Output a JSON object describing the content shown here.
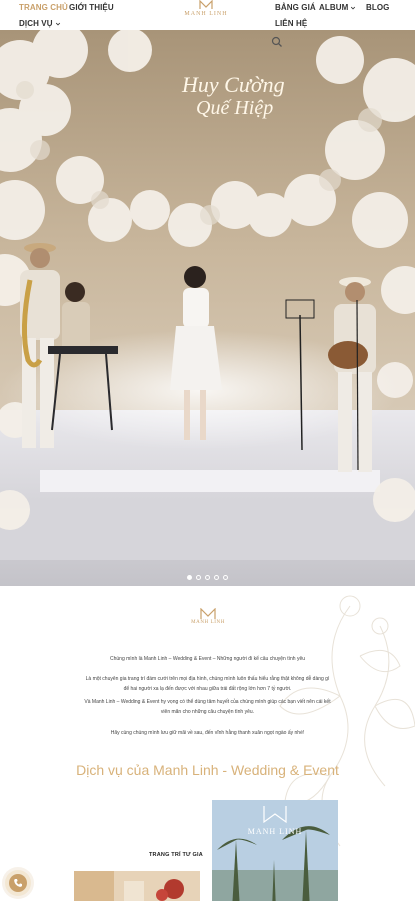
{
  "nav": {
    "home": "TRANG CHỦ",
    "about": "GIỚI THIỆU",
    "services": "DỊCH VỤ",
    "pricing": "BẢNG GIÁ",
    "album": "ALBUM",
    "blog": "BLOG",
    "contact": "LIÊN HỆ"
  },
  "brand": {
    "logo_text": "MANH LINH",
    "accent_color": "#c9a06a"
  },
  "hero": {
    "neon_text_1": "Huy Cường",
    "neon_text_2": "Quế Hiệp",
    "slide_count": 5,
    "active_slide": 1
  },
  "intro": {
    "logo_text": "MANH LINH",
    "paragraphs": [
      "Chúng mình là Manh Linh – Wedding & Event – Những người đi kể câu chuyện tình yêu",
      "Là một chuyên gia trang trí đám cưới trên mọi địa hình, chúng mình luôn thấu hiểu rằng thật không dễ dàng gì",
      "để hai người xa lạ đến được với nhau giữa trái đất rộng lớn hơn 7 tỷ người.",
      "Và Manh Linh – Wedding & Event hy vọng có thể dùng tâm huyết của chúng mình giúp các bạn viết nên cái kết",
      "viên mãn cho những câu chuyện tình yêu.",
      "Hãy cùng chúng mình lưu giữ mãi về sau, đến vĩnh hằng thanh xuân ngọt ngào ấy nhé!"
    ],
    "services_title": "Dịch vụ của Manh Linh - Wedding & Event",
    "card_label": "TRANG TRÍ TƯ GIA",
    "card_logo_text": "MANH LINH"
  },
  "icons": {
    "search": "search-icon",
    "phone": "phone-icon",
    "caret": "chevron-down-icon"
  }
}
